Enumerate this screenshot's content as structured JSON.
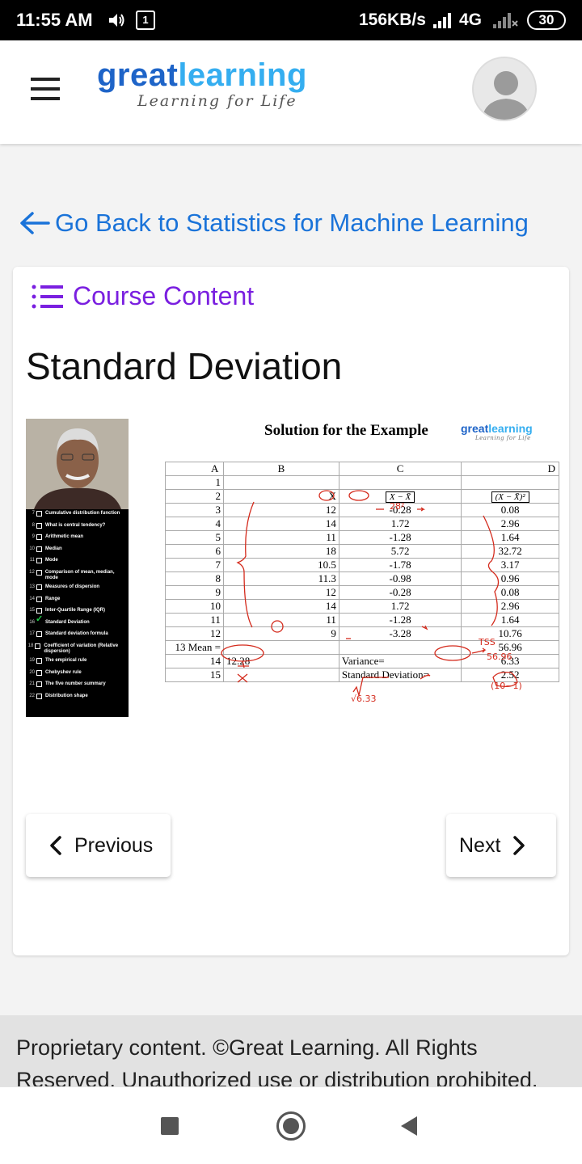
{
  "status_bar": {
    "time": "11:55 AM",
    "notification_count": "1",
    "speed": "156KB/s",
    "network": "4G",
    "battery": "30"
  },
  "header": {
    "logo_great": "great",
    "logo_learning": "learning",
    "logo_tagline": "Learning for Life"
  },
  "back_link": {
    "label": "Go Back to Statistics for Machine Learning"
  },
  "course_content": {
    "label": "Course Content"
  },
  "page_title": "Standard Deviation",
  "slide": {
    "title": "Solution for the Example",
    "logo_great": "great",
    "logo_learning": "learning",
    "logo_tagline": "Learning for Life",
    "toc": [
      {
        "num": "7",
        "text": "Cumulative distribution function",
        "checked": false
      },
      {
        "num": "8",
        "text": "What is central tendency?",
        "checked": false
      },
      {
        "num": "9",
        "text": "Arithmetic mean",
        "checked": false
      },
      {
        "num": "10",
        "text": "Median",
        "checked": false
      },
      {
        "num": "11",
        "text": "Mode",
        "checked": false
      },
      {
        "num": "12",
        "text": "Comparison of mean, median, mode",
        "checked": false
      },
      {
        "num": "13",
        "text": "Measures of dispersion",
        "checked": false
      },
      {
        "num": "14",
        "text": "Range",
        "checked": false
      },
      {
        "num": "15",
        "text": "Inter-Quartile Range (IQR)",
        "checked": false
      },
      {
        "num": "16",
        "text": "Standard Deviation",
        "checked": true
      },
      {
        "num": "17",
        "text": "Standard deviation formula",
        "checked": false
      },
      {
        "num": "18",
        "text": "Coefficient of variation (Relative dispersion)",
        "checked": false
      },
      {
        "num": "19",
        "text": "The empirical rule",
        "checked": false
      },
      {
        "num": "20",
        "text": "Chebyshev rule",
        "checked": false
      },
      {
        "num": "21",
        "text": "The five number summary",
        "checked": false
      },
      {
        "num": "22",
        "text": "Distribution shape",
        "checked": false
      }
    ],
    "sheet": {
      "columns": [
        "A",
        "B",
        "C",
        "D"
      ],
      "header_row": {
        "num": "2",
        "b": "X",
        "c": "X − X̄",
        "d": "(X − X̄)²"
      },
      "rows": [
        {
          "num": "1",
          "b": "",
          "c": "",
          "d": ""
        },
        {
          "num": "3",
          "b": "12",
          "c": "-0.28",
          "d": "0.08"
        },
        {
          "num": "4",
          "b": "14",
          "c": "1.72",
          "d": "2.96"
        },
        {
          "num": "5",
          "b": "11",
          "c": "-1.28",
          "d": "1.64"
        },
        {
          "num": "6",
          "b": "18",
          "c": "5.72",
          "d": "32.72"
        },
        {
          "num": "7",
          "b": "10.5",
          "c": "-1.78",
          "d": "3.17"
        },
        {
          "num": "8",
          "b": "11.3",
          "c": "-0.98",
          "d": "0.96"
        },
        {
          "num": "9",
          "b": "12",
          "c": "-0.28",
          "d": "0.08"
        },
        {
          "num": "10",
          "b": "14",
          "c": "1.72",
          "d": "2.96"
        },
        {
          "num": "11",
          "b": "11",
          "c": "-1.28",
          "d": "1.64"
        },
        {
          "num": "12",
          "b": "9",
          "c": "-3.28",
          "d": "10.76"
        }
      ],
      "mean_row": {
        "num": "13",
        "label": "Mean =",
        "d": "56.96"
      },
      "variance_row": {
        "num": "14",
        "b": "12.28",
        "label": "Variance=",
        "d": "6.33"
      },
      "sd_row": {
        "num": "15",
        "label": "Standard Deviation=",
        "d": "2.52"
      }
    },
    "annotations": {
      "note_1": "28²",
      "note_tss": "TSS",
      "note_5696": "56.96",
      "note_10_1": "(10−1)",
      "note_sqrt": "√6.33"
    }
  },
  "nav": {
    "previous_label": "Previous",
    "next_label": "Next"
  },
  "footer": {
    "text": "Proprietary content. ©Great Learning. All Rights Reserved. Unauthorized use or distribution prohibited."
  },
  "colors": {
    "brand_dark_blue": "#1e64c8",
    "brand_light_blue": "#35aef0",
    "link_blue": "#1a73d9",
    "course_purple": "#7a1fe0",
    "annotation_red": "#d42a1c"
  }
}
